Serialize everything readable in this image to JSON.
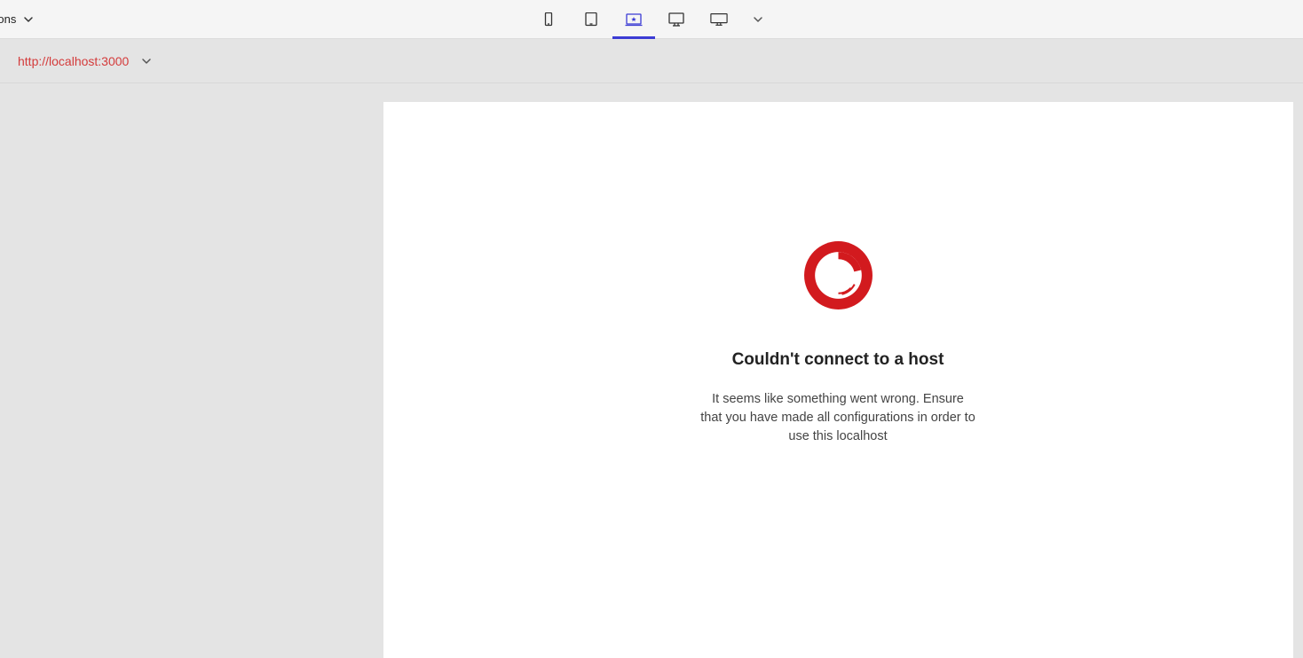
{
  "toolbar": {
    "left_label": "sions"
  },
  "url_bar": {
    "url": "http://localhost:3000"
  },
  "error": {
    "heading": "Couldn't connect to a host",
    "message": "It seems like something went wrong. Ensure that you have made all configurations in order to use this localhost"
  },
  "colors": {
    "accent": "#3b3bd4",
    "error_red": "#d21a1e",
    "url_red": "#d43b3b"
  }
}
